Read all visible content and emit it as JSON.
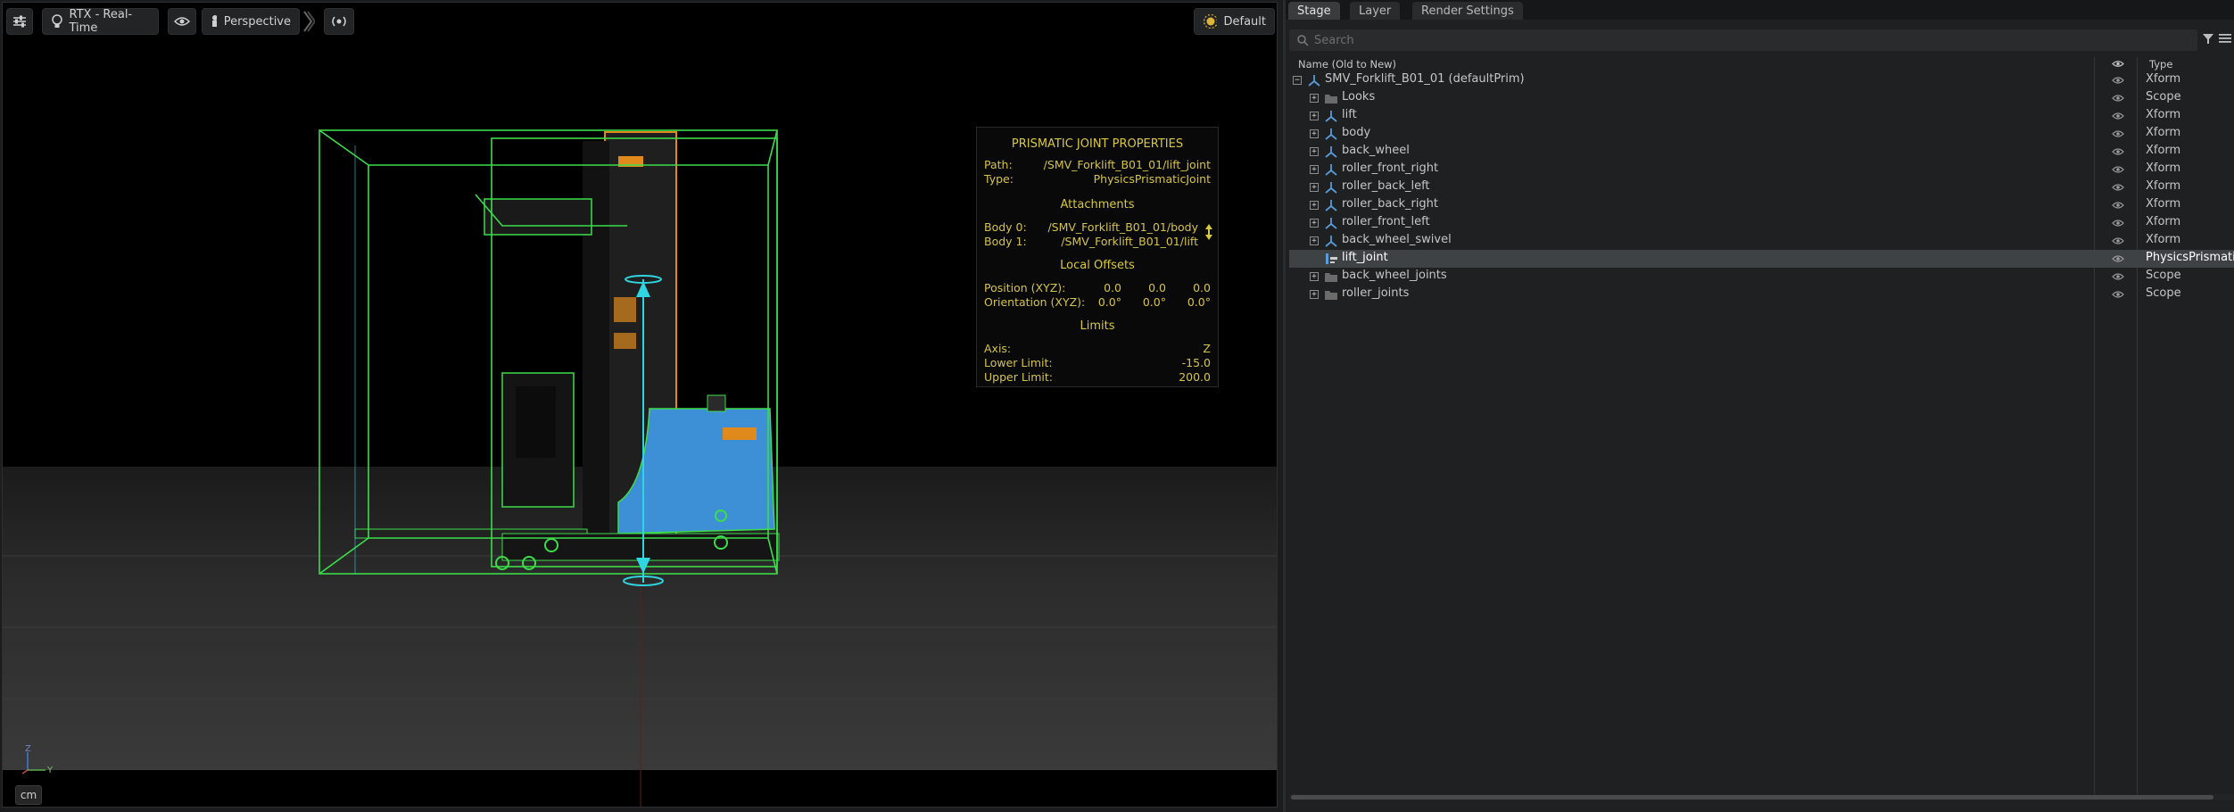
{
  "viewport": {
    "renderer_label": "RTX - Real-Time",
    "camera_label": "Perspective",
    "lighting_label": "Default",
    "unit_label": "cm",
    "axis_labels": {
      "z": "Z",
      "y": "Y"
    }
  },
  "joint_panel": {
    "title": "PRISMATIC JOINT PROPERTIES",
    "path_key": "Path:",
    "path_value": "/SMV_Forklift_B01_01/lift_joint",
    "type_key": "Type:",
    "type_value": "PhysicsPrismaticJoint",
    "attachments_title": "Attachments",
    "body0_key": "Body 0:",
    "body0_value": "/SMV_Forklift_B01_01/body",
    "body1_key": "Body 1:",
    "body1_value": "/SMV_Forklift_B01_01/lift",
    "offsets_title": "Local Offsets",
    "position_key": "Position (XYZ):",
    "position_values": [
      "0.0",
      "0.0",
      "0.0"
    ],
    "orientation_key": "Orientation (XYZ):",
    "orientation_values": [
      "0.0°",
      "0.0°",
      "0.0°"
    ],
    "limits_title": "Limits",
    "axis_key": "Axis:",
    "axis_value": "Z",
    "lower_key": "Lower Limit:",
    "lower_value": "-15.0",
    "upper_key": "Upper Limit:",
    "upper_value": "200.0"
  },
  "stage": {
    "tabs": [
      {
        "label": "Stage",
        "active": true
      },
      {
        "label": "Layer",
        "active": false
      },
      {
        "label": "Render Settings",
        "active": false
      }
    ],
    "search_placeholder": "Search",
    "columns": {
      "name": "Name (Old to New)",
      "type": "Type"
    },
    "rows": [
      {
        "label": "SMV_Forklift_B01_01 (defaultPrim)",
        "type": "Xform",
        "icon": "xform-icon",
        "depth": 0,
        "expander": "−",
        "selected": false
      },
      {
        "label": "Looks",
        "type": "Scope",
        "icon": "folder-icon",
        "depth": 1,
        "expander": "+",
        "selected": false
      },
      {
        "label": "lift",
        "type": "Xform",
        "icon": "xform-icon",
        "depth": 1,
        "expander": "+",
        "selected": false
      },
      {
        "label": "body",
        "type": "Xform",
        "icon": "xform-icon",
        "depth": 1,
        "expander": "+",
        "selected": false
      },
      {
        "label": "back_wheel",
        "type": "Xform",
        "icon": "xform-icon",
        "depth": 1,
        "expander": "+",
        "selected": false
      },
      {
        "label": "roller_front_right",
        "type": "Xform",
        "icon": "xform-icon",
        "depth": 1,
        "expander": "+",
        "selected": false
      },
      {
        "label": "roller_back_left",
        "type": "Xform",
        "icon": "xform-icon",
        "depth": 1,
        "expander": "+",
        "selected": false
      },
      {
        "label": "roller_back_right",
        "type": "Xform",
        "icon": "xform-icon",
        "depth": 1,
        "expander": "+",
        "selected": false
      },
      {
        "label": "roller_front_left",
        "type": "Xform",
        "icon": "xform-icon",
        "depth": 1,
        "expander": "+",
        "selected": false
      },
      {
        "label": "back_wheel_swivel",
        "type": "Xform",
        "icon": "xform-icon",
        "depth": 1,
        "expander": "+",
        "selected": false
      },
      {
        "label": "lift_joint",
        "type": "PhysicsPrismatic",
        "icon": "joint-icon",
        "depth": 1,
        "expander": "",
        "selected": true
      },
      {
        "label": "back_wheel_joints",
        "type": "Scope",
        "icon": "folder-icon",
        "depth": 1,
        "expander": "+",
        "selected": false
      },
      {
        "label": "roller_joints",
        "type": "Scope",
        "icon": "folder-icon",
        "depth": 1,
        "expander": "+",
        "selected": false
      }
    ]
  },
  "colors": {
    "panel_text": "#d8c842",
    "selection": "#3e4245",
    "bbox_green": "#3ddc4a",
    "joint_cyan": "#2fd5e0",
    "forklift_blue": "#3d8fd6",
    "accent_orange": "#e08a1e"
  }
}
